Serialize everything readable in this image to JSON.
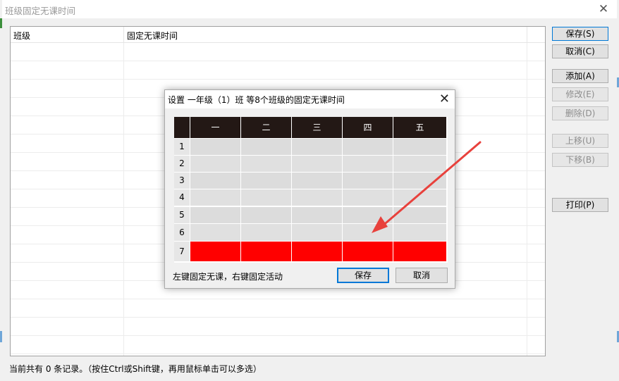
{
  "window": {
    "title": "班级固定无课时间",
    "close_glyph": "✕"
  },
  "list": {
    "columns": [
      "班级",
      "固定无课时间"
    ],
    "rows": []
  },
  "side_buttons": {
    "save": "保存(S)",
    "cancel": "取消(C)",
    "add": "添加(A)",
    "edit": "修改(E)",
    "delete": "删除(D)",
    "move_up": "上移(U)",
    "move_down": "下移(B)",
    "print": "打印(P)"
  },
  "status": "当前共有 0 条记录。（按住Ctrl或Shift键，再用鼠标单击可以多选）",
  "dialog": {
    "title": "设置 一年级（1）班 等8个班级的固定无课时间",
    "close_glyph": "✕",
    "days": [
      "一",
      "二",
      "三",
      "四",
      "五"
    ],
    "periods": [
      "1",
      "2",
      "3",
      "4",
      "5",
      "6",
      "7"
    ],
    "fixed_free_period": "7",
    "hint": "左键固定无课，右键固定活动",
    "save_label": "保存",
    "cancel_label": "取消"
  },
  "colors": {
    "fixed_slot": "#ff0000",
    "header_bg": "#231815",
    "empty_slot": "#dcdcdc",
    "annotation_arrow": "#e8413c"
  }
}
